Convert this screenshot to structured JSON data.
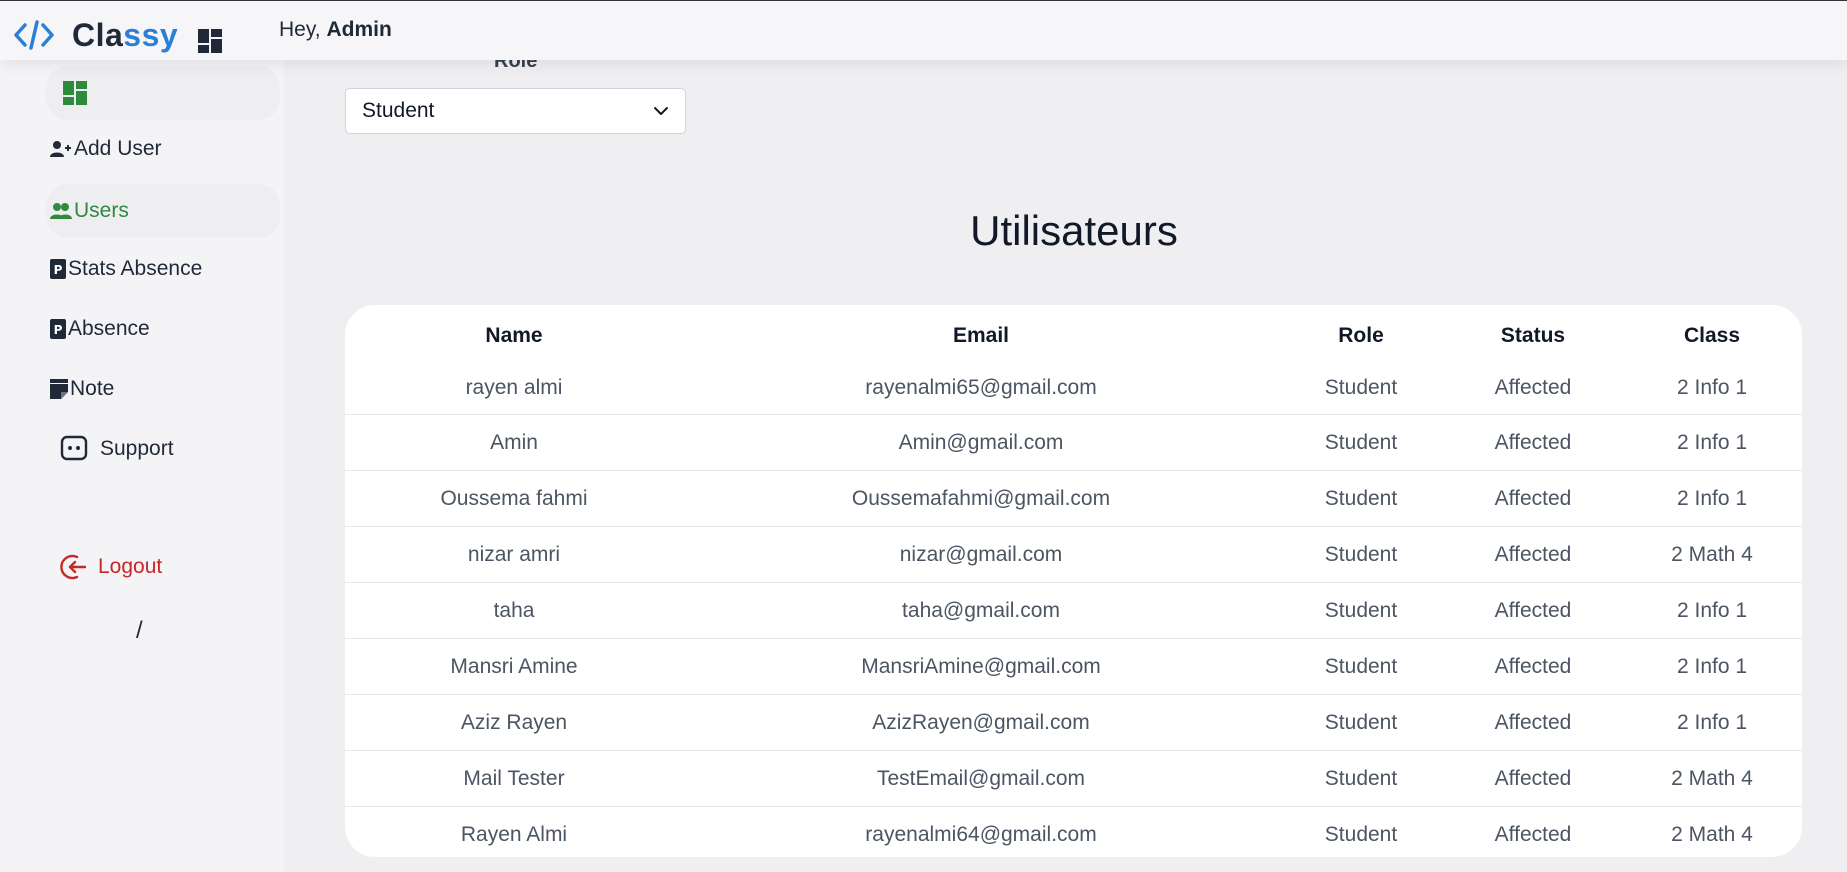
{
  "header": {
    "logo_part1": "Cla",
    "logo_part2": "ssy",
    "greeting_prefix": "Hey, ",
    "greeting_user": "Admin"
  },
  "sidebar": {
    "items": [
      {
        "label": "",
        "icon": "dashboard-icon"
      },
      {
        "label": "Add User",
        "icon": "user-plus-icon"
      },
      {
        "label": "Users",
        "icon": "users-icon"
      },
      {
        "label": "Stats Absence",
        "icon": "parking-icon"
      },
      {
        "label": "Absence",
        "icon": "parking-icon"
      },
      {
        "label": "Note",
        "icon": "note-icon"
      },
      {
        "label": "Support",
        "icon": "chat-icon"
      }
    ],
    "logout_label": "Logout",
    "footer_text": "/"
  },
  "filter": {
    "role_label": "Role",
    "role_value": "Student"
  },
  "main": {
    "title": "Utilisateurs"
  },
  "table": {
    "columns": [
      "Name",
      "Email",
      "Role",
      "Status",
      "Class"
    ],
    "rows": [
      {
        "name": "rayen almi",
        "email": "rayenalmi65@gmail.com",
        "role": "Student",
        "status": "Affected",
        "class": "2 Info 1"
      },
      {
        "name": "Amin",
        "email": "Amin@gmail.com",
        "role": "Student",
        "status": "Affected",
        "class": "2 Info 1"
      },
      {
        "name": "Oussema fahmi",
        "email": "Oussemafahmi@gmail.com",
        "role": "Student",
        "status": "Affected",
        "class": "2 Info 1"
      },
      {
        "name": "nizar amri",
        "email": "nizar@gmail.com",
        "role": "Student",
        "status": "Affected",
        "class": "2 Math 4"
      },
      {
        "name": "taha",
        "email": "taha@gmail.com",
        "role": "Student",
        "status": "Affected",
        "class": "2 Info 1"
      },
      {
        "name": "Mansri Amine",
        "email": "MansriAmine@gmail.com",
        "role": "Student",
        "status": "Affected",
        "class": "2 Info 1"
      },
      {
        "name": "Aziz Rayen",
        "email": "AzizRayen@gmail.com",
        "role": "Student",
        "status": "Affected",
        "class": "2 Info 1"
      },
      {
        "name": "Mail Tester",
        "email": "TestEmail@gmail.com",
        "role": "Student",
        "status": "Affected",
        "class": "2 Math 4"
      },
      {
        "name": "Rayen Almi",
        "email": "rayenalmi64@gmail.com",
        "role": "Student",
        "status": "Affected",
        "class": "2 Math 4"
      }
    ]
  },
  "colors": {
    "brand_blue": "#2b7fd6",
    "active_green": "#2e8b3e",
    "logout_red": "#c62828"
  }
}
